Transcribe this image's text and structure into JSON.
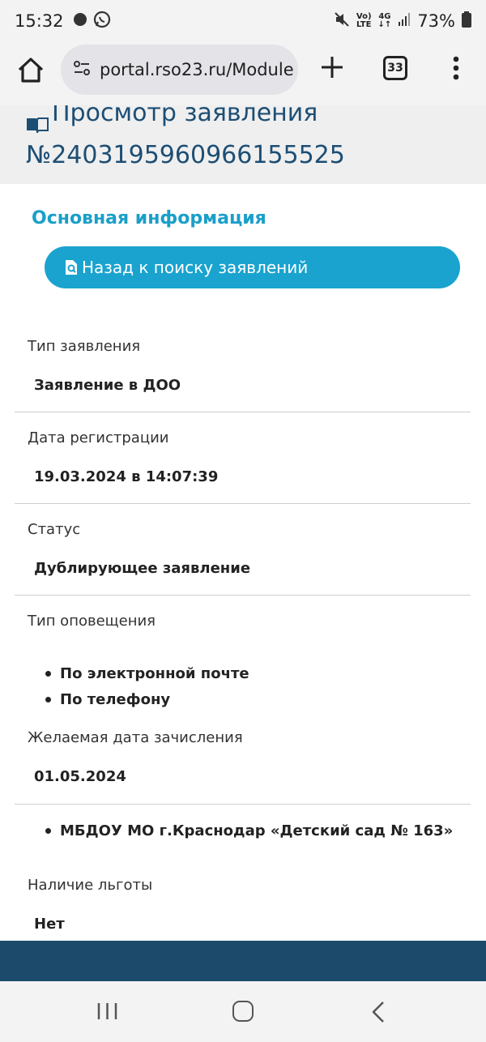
{
  "status_bar": {
    "time": "15:32",
    "network_top": "Vo)",
    "network_bottom": "LTE",
    "gen": "4G",
    "battery": "73%"
  },
  "browser": {
    "url": "portal.rso23.ru/Module",
    "tab_count": "33"
  },
  "page": {
    "title_line1": "Просмотр заявления",
    "title_line2": "№2403195960966155525",
    "section_title": "Основная информация",
    "back_button": "Назад к поиску заявлений"
  },
  "fields": {
    "type_label": "Тип заявления",
    "type_value": "Заявление в ДОО",
    "date_label": "Дата регистрации",
    "date_value": "19.03.2024 в 14:07:39",
    "status_label": "Статус",
    "status_value": "Дублирующее заявление",
    "notify_label": "Тип оповещения",
    "notify_items": [
      "По электронной почте",
      "По телефону"
    ],
    "desired_label": "Желаемая дата зачисления",
    "desired_value": "01.05.2024",
    "org_items": [
      "МБДОУ МО г.Краснодар «Детский сад № 163»"
    ],
    "benefit_label": "Наличие льготы",
    "benefit_value": "Нет"
  },
  "colors": {
    "accent": "#1aa3cf",
    "header_text": "#1d4e74",
    "footer": "#1c4a6a"
  }
}
